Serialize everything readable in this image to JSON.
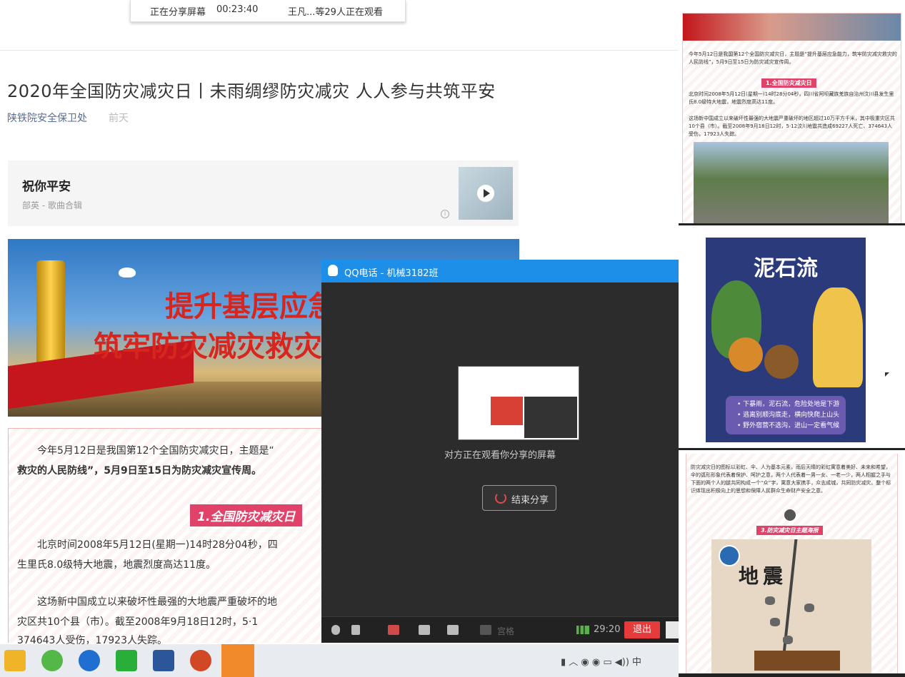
{
  "share_bar": {
    "status": "正在分享屏幕",
    "elapsed": "00:23:40",
    "viewers": "王凡...等29人正在观看"
  },
  "article": {
    "title": "2020年全国防灾减灾日丨未雨绸缪防灾减灾 人人参与共筑平安",
    "source": "陕铁院安全保卫处",
    "date": "前天"
  },
  "music": {
    "title": "祝你平安",
    "artist": "部英 - 歌曲合辑"
  },
  "banner": {
    "line1": "提升基层应急",
    "line2": "筑牢防灾减灾救灾"
  },
  "body": {
    "p1a": "今年5月12日是我国第12个全国防灾减灾日，主题是“",
    "p1b": "救灾的人民防线”，5月9日至15日为防灾减灾宣传周。",
    "section": "1.全国防灾减灾日",
    "p2a": "北京时间2008年5月12日(星期一)14时28分04秒，四",
    "p2b": "生里氏8.0级特大地震，地震烈度高达11度。",
    "p3a": "这场新中国成立以来破坏性最强的大地震严重破坏的地",
    "p3b": "灾区共10个县（市）。截至2008年9月18日12时，5·1",
    "p3c": "374643人受伤，17923人失踪。"
  },
  "qq_call": {
    "title": "QQ电话 - 机械3182班",
    "watching_text": "对方正在观看你分享的屏幕",
    "end_share": "结束分享",
    "grid_label": "宫格",
    "timer": "29:20",
    "exit": "退出"
  },
  "right_panel1": {
    "p1": "今年5月12日是我国第12个全国防灾减灾日，主题是“提升基层应急能力，筑牢防灾减灾救灾的人民防线”，5月9日至15日为防灾减灾宣传周。",
    "tag": "1.全国防灾减灾日",
    "p2": "北京时间2008年5月12日(星期一)14时28分04秒，四川省阿坝藏族羌族自治州汶川县发生里氏8.0级特大地震，地震烈度高达11度。",
    "p3": "这场新中国成立以来破坏性最强的大地震严重破坏的地区超过10万平方千米，其中极重灾区共10个县（市）。截至2008年9月18日12时，5·12汶川地震共造成69227人死亡、374643人受伤，17923人失踪。"
  },
  "right_panel2": {
    "title": "泥石流",
    "line1": "• 下暴雨，泥石流，危险处地是下游",
    "line2": "• 逃离别顺沟底走，横向快爬上山头",
    "line3": "• 野外宿营不选沟，进山一定看气候"
  },
  "right_panel3": {
    "p1": "防灾减灾日的图标以彩虹、伞、人为基本元素，雨后天晴的彩虹寓意着美好、未来和希望，伞的弧形形象代表着保护、呵护之意，两个人代表着一男一女、一老一少，两人相握之手与下面的两个人的腿共同构成一个“众”字，寓意大家携手，众志成城，共同防灾减灾。整个标识体现出积极向上的思想和保障人民群众生命财产安全之意。",
    "tag": "3.防灾减灾日主题海报",
    "poster_title": "地震"
  },
  "colors": {
    "qq_blue": "#1e8fe8",
    "section_pink": "#e0426a",
    "banner_red": "#d7261e",
    "exit_red": "#e63b3b"
  }
}
